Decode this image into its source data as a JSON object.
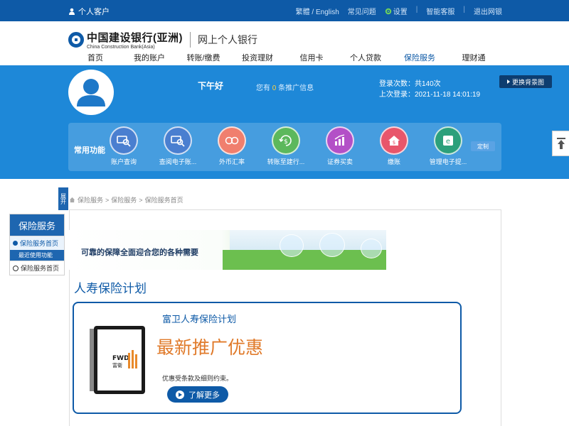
{
  "topbar": {
    "user_label": "个人客户",
    "links": [
      "繁體 / English",
      "常见问题",
      "设置",
      "智能客服",
      "退出网银"
    ]
  },
  "header": {
    "logo_cn": "中国建设银行(亚洲)",
    "logo_en": "China Construction Bank(Asia)",
    "subtitle": "网上个人银行"
  },
  "nav": {
    "items": [
      "首页",
      "我的账户",
      "转账/缴费",
      "投资理财",
      "信用卡",
      "个人贷款",
      "保险服务",
      "理财通"
    ],
    "active": "保险服务"
  },
  "banner": {
    "greeting": "下午好",
    "promo_prefix": "您有",
    "promo_count": "0",
    "promo_suffix": "条推广信息",
    "login_count": "登录次数：共140次",
    "last_login": "上次登录：2021-11-18 14:01:19",
    "bg_button": "更换背景图"
  },
  "quick_functions": {
    "title": "常用功能",
    "items": [
      {
        "label": "账户查询",
        "icon": "account-search-icon",
        "color": "#4a7fd0"
      },
      {
        "label": "查阅电子账...",
        "icon": "statement-search-icon",
        "color": "#4a7fd0"
      },
      {
        "label": "外币汇率",
        "icon": "currency-exchange-icon",
        "color": "#f07f6e"
      },
      {
        "label": "转账至建行...",
        "icon": "transfer-icon",
        "color": "#5cb85c"
      },
      {
        "label": "证券买卖",
        "icon": "securities-chart-icon",
        "color": "#b350c7"
      },
      {
        "label": "缴账",
        "icon": "bill-house-icon",
        "color": "#e8566b"
      },
      {
        "label": "管理电子提...",
        "icon": "e-statement-icon",
        "color": "#2ca07b"
      }
    ],
    "custom_button": "定制"
  },
  "sidebar": {
    "expand_label": "展开",
    "heading": "保险服务",
    "item_home": "保险服务首页",
    "recent_heading": "最近使用功能",
    "recent_item": "保险服务首页"
  },
  "breadcrumb": [
    "保险服务",
    "保险服务",
    "保险服务首页"
  ],
  "hero": {
    "text": "可靠的保障全面迎合您的各种需要"
  },
  "section": {
    "title": "人寿保险计划"
  },
  "card": {
    "plan_name": "富卫人寿保险计划",
    "headline": "最新推广优惠",
    "terms": "优惠受条款及细则约束。",
    "more_button": "了解更多",
    "brand_logo": "FWD 富衛"
  },
  "colors": {
    "primary": "#0e5aa7",
    "banner": "#1e88d8",
    "accent_orange": "#e07a2a"
  }
}
